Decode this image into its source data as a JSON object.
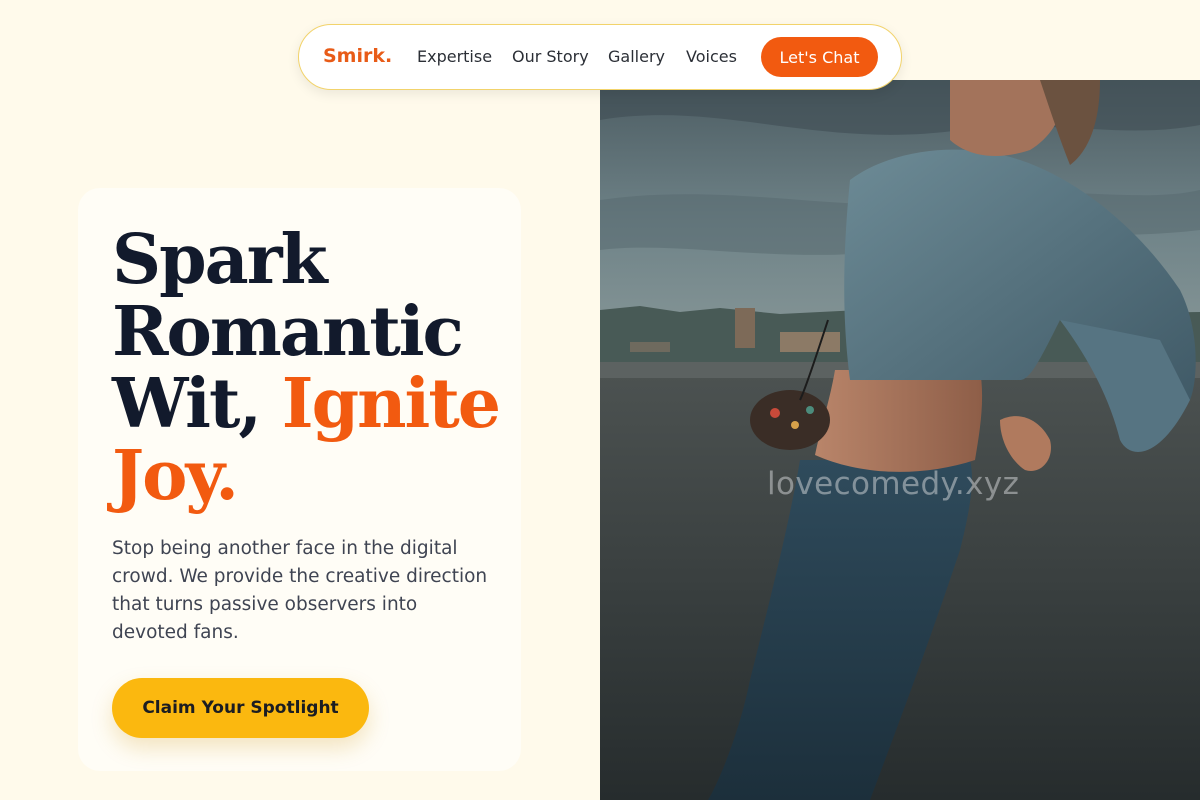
{
  "nav": {
    "brand": "Smirk.",
    "links": [
      "Expertise",
      "Our Story",
      "Gallery",
      "Voices"
    ],
    "cta": "Let's Chat"
  },
  "hero": {
    "headline_lines": [
      "Spark",
      "Romantic",
      "Wit, "
    ],
    "headline_accent_1": "Ignite",
    "headline_accent_2": "Joy.",
    "subtext": "Stop being another face in the digital crowd. We provide the creative direction that turns passive observers into devoted fans.",
    "cta": "Claim Your Spotlight"
  },
  "image": {
    "watermark": "lovecomedy.xyz"
  },
  "colors": {
    "background": "#fffaeb",
    "accent": "#f25a10",
    "cta_yellow": "#fbb80f",
    "headline": "#121a2c"
  }
}
